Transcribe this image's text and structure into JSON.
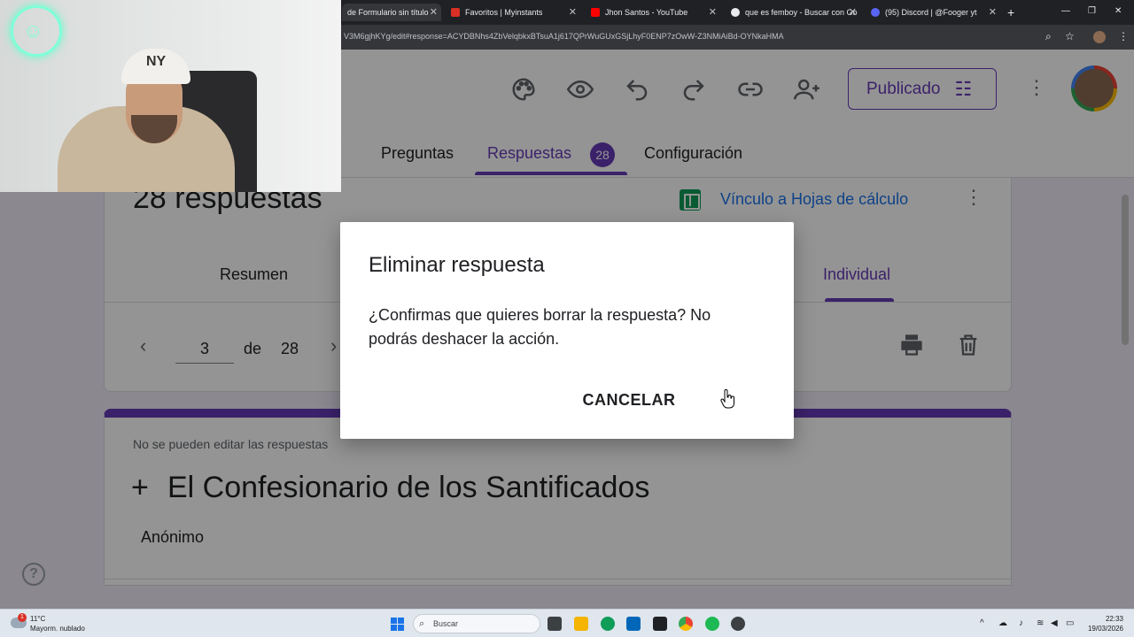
{
  "browser": {
    "tabs": [
      {
        "label": "de Formulario sin título",
        "favicon_color": "#673ab7",
        "active": true
      },
      {
        "label": "Favoritos | Myinstants",
        "favicon_color": "#d93025",
        "active": false
      },
      {
        "label": "Jhon Santos - YouTube",
        "favicon_color": "#ff0000",
        "active": false
      },
      {
        "label": "que es femboy - Buscar con Go",
        "favicon_color": "#e8eaed",
        "active": false
      },
      {
        "label": "(95) Discord | @Fooger yt",
        "favicon_color": "#5865f2",
        "active": false
      }
    ],
    "url": "V3M6gjhKYg/edit#response=ACYDBNhs4ZbVelqbkxBTsuA1j617QPrWuGUxGSjLhyF0ENP7zOwW-Z3NMiAiBd-OYNkaHMA"
  },
  "header": {
    "publish_label": "Publicado",
    "tabs": [
      {
        "label": "Preguntas"
      },
      {
        "label": "Respuestas",
        "count": "28"
      },
      {
        "label": "Configuración"
      }
    ]
  },
  "responses": {
    "title": "28 respuestas",
    "sheets_link": "Vínculo a Hojas de cálculo",
    "subtabs": [
      "Resumen",
      "Individual"
    ],
    "pager": {
      "current": "3",
      "of": "de",
      "total": "28"
    }
  },
  "form": {
    "notice": "No se pueden editar las respuestas",
    "plus": "+",
    "title": "El Confesionario de los Santificados",
    "anon": "Anónimo"
  },
  "dialog": {
    "title": "Eliminar respuesta",
    "message": "¿Confirmas que quieres borrar la respuesta? No podrás deshacer la acción.",
    "cancel": "CANCELAR"
  },
  "taskbar": {
    "temp": "11°C",
    "weather": "Mayorm. nublado",
    "weather_badge": "1",
    "search": "Buscar",
    "time": "22:33",
    "date": "19/03/2026"
  },
  "colors": {
    "accent": "#673ab7",
    "link": "#1a73e8",
    "sheets": "#0f9d58"
  }
}
